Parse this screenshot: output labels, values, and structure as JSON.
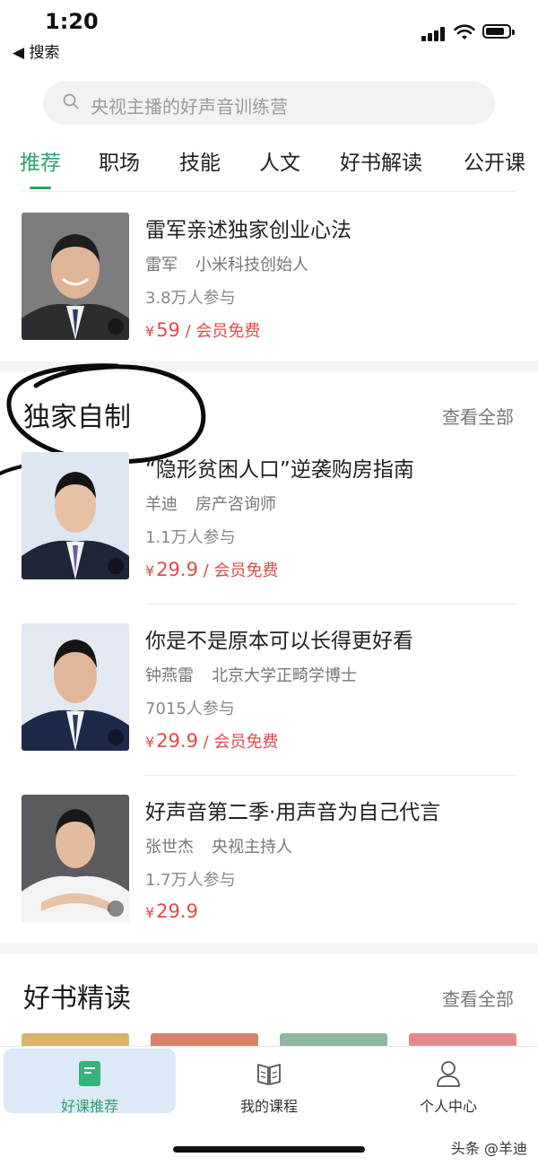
{
  "status_bar": {
    "time": "1:20",
    "back_label": "◀ 搜索"
  },
  "search": {
    "placeholder": "央视主播的好声音训练营"
  },
  "tabs": [
    {
      "label": "推荐",
      "active": true
    },
    {
      "label": "职场"
    },
    {
      "label": "技能"
    },
    {
      "label": "人文"
    },
    {
      "label": "好书解读"
    },
    {
      "label": "公开课"
    }
  ],
  "top_course": {
    "title": "雷军亲述独家创业心法",
    "author": "雷军",
    "role": "小米科技创始人",
    "participants": "3.8万人参与",
    "price": "59",
    "member": " / 会员免费"
  },
  "exclusive": {
    "title": "独家自制",
    "see_all": "查看全部",
    "courses": [
      {
        "title": "“隐形贫困人口”逆袭购房指南",
        "author": "羊迪",
        "role": "房产咨询师",
        "participants": "1.1万人参与",
        "price": "29.9",
        "member": " / 会员免费"
      },
      {
        "title": "你是不是原本可以长得更好看",
        "author": "钟燕雷",
        "role": "北京大学正畸学博士",
        "participants": "7015人参与",
        "price": "29.9",
        "member": " / 会员免费"
      },
      {
        "title": "好声音第二季·用声音为自己代言",
        "author": "张世杰",
        "role": "央视主持人",
        "participants": "1.7万人参与",
        "price": "29.9",
        "member": ""
      }
    ]
  },
  "books": {
    "title": "好书精读",
    "see_all": "查看全部"
  },
  "currency_symbol": "¥",
  "bottom_nav": [
    {
      "label": "好课推荐",
      "icon": "book-icon",
      "active": true
    },
    {
      "label": "我的课程",
      "icon": "open-book-icon"
    },
    {
      "label": "个人中心",
      "icon": "person-icon"
    }
  ],
  "watermark": "头条 @羊迪",
  "colors": {
    "accent": "#2fa36b",
    "price": "#e24a4a",
    "nav_active_bg": "#dce9f7"
  }
}
